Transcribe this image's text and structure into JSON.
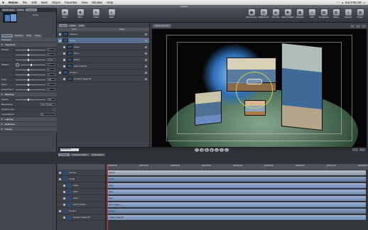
{
  "menubar": {
    "apple": "",
    "items": [
      "Motion",
      "File",
      "Edit",
      "Mark",
      "Object",
      "Favorites",
      "View",
      "Window",
      "Help"
    ],
    "clock": "Sat 9:08 AM"
  },
  "window": {
    "title": "untitled"
  },
  "toolbar": {
    "left": [
      {
        "label": "Select",
        "icon": "arrow-icon"
      },
      {
        "label": "Move",
        "icon": "move-icon"
      },
      {
        "label": "Create",
        "icon": "pen-icon"
      },
      {
        "label": "Mask",
        "icon": "mask-icon"
      }
    ],
    "right": [
      {
        "label": "New Camera",
        "icon": "camera-icon"
      },
      {
        "label": "Add Behavior",
        "icon": "gear-icon"
      },
      {
        "label": "Add Filter",
        "icon": "filter-icon"
      },
      {
        "label": "Make Particles",
        "icon": "particles-icon"
      },
      {
        "label": "Replicate",
        "icon": "replicate-icon"
      },
      {
        "label": "HUD",
        "icon": "hud-icon"
      },
      {
        "label": "File Browser",
        "icon": "folder-icon"
      },
      {
        "label": "Library",
        "icon": "library-icon"
      },
      {
        "label": "Inspector",
        "icon": "info-icon"
      },
      {
        "label": "Project",
        "icon": "project-icon"
      }
    ]
  },
  "left_panel": {
    "tabs": [
      "File Browser",
      "Library",
      "Inspector"
    ],
    "active_tab": "Inspector",
    "preview_name": "Group",
    "inspector_tabs": [
      "Properties",
      "Behaviors",
      "Filters",
      "Group"
    ],
    "active_inspector_tab": "Properties",
    "params": [
      {
        "name": "Parameter",
        "type": "hdr"
      },
      {
        "name": "Transform",
        "type": "section"
      },
      {
        "name": "Position",
        "value": "0",
        "ctrl": "slider"
      },
      {
        "name": "",
        "value": "0",
        "ctrl": "slider"
      },
      {
        "name": "",
        "value": "40.09",
        "ctrl": "slider"
      },
      {
        "name": "Rotation",
        "value": "0",
        "ctrl": "dial"
      },
      {
        "name": "",
        "value": "0",
        "ctrl": "slider"
      },
      {
        "name": "",
        "value": "0",
        "ctrl": "slider"
      },
      {
        "name": "Scale",
        "value": "100",
        "ctrl": "slider"
      },
      {
        "name": "Shear",
        "value": "0",
        "ctrl": "slider"
      },
      {
        "name": "Anchor Point",
        "value": "0",
        "ctrl": "slider"
      },
      {
        "name": "Blending",
        "type": "section"
      },
      {
        "name": "Opacity",
        "value": "100",
        "ctrl": "slider"
      },
      {
        "name": "Blend Mode",
        "value": "Pass Through",
        "ctrl": "popup"
      },
      {
        "name": "Preserve Opacity",
        "value": "",
        "ctrl": "check"
      },
      {
        "name": "Casts Reflection",
        "value": "No",
        "ctrl": "popup"
      },
      {
        "name": "Lighting",
        "type": "section"
      },
      {
        "name": "Reflection",
        "type": "section"
      },
      {
        "name": "Timing",
        "type": "section"
      }
    ]
  },
  "layers_panel": {
    "tabs": [
      "Layers",
      "Media",
      "Audio"
    ],
    "active_tab": "Layers",
    "columns": [
      "Name",
      "Status"
    ],
    "rows": [
      {
        "name": "Camera",
        "indent": 0,
        "selected": false
      },
      {
        "name": "Group",
        "indent": 0,
        "selected": true
      },
      {
        "name": "Apple",
        "indent": 1,
        "selected": false
      },
      {
        "name": "Hall 1",
        "indent": 1,
        "selected": false
      },
      {
        "name": "Hall 2",
        "indent": 1,
        "selected": false
      },
      {
        "name": "Hall of Hearts",
        "indent": 1,
        "selected": false
      },
      {
        "name": "Group 1",
        "indent": 0,
        "selected": false
      },
      {
        "name": "Gradient Stage 08",
        "indent": 1,
        "selected": false
      }
    ]
  },
  "canvas": {
    "view_menu": "Active Camera",
    "accent": "#c2d24a"
  },
  "transport": {
    "timecode": "00:00:00:00",
    "buttons": [
      "⏮",
      "◀",
      "▶",
      "▶",
      "⏭",
      "⟲",
      "🔊"
    ]
  },
  "timeline": {
    "tabs": [
      "Timeline",
      "Keyframe Editor",
      "Audio Editor"
    ],
    "active_tab": "Timeline",
    "ruler": [
      "00:00:00:00",
      "00:00:01:00",
      "00:00:02:00",
      "00:00:03:00",
      "00:00:04:00",
      "00:00:05:00",
      "00:00:06:00",
      "00:00:07:00",
      "00:00:08:00"
    ],
    "rows": [
      {
        "name": "Camera",
        "bar_label": "Camera",
        "kind": "cam"
      },
      {
        "name": "Group",
        "bar_label": "Group",
        "kind": "grp"
      },
      {
        "name": "Apple",
        "bar_label": "Apple",
        "kind": "layer"
      },
      {
        "name": "Hall 1",
        "bar_label": "Hall 1",
        "kind": "layer"
      },
      {
        "name": "Hall 2",
        "bar_label": "Hall 2",
        "kind": "layer"
      },
      {
        "name": "Hall of Hearts",
        "bar_label": "Hall of Hearts",
        "kind": "layer"
      },
      {
        "name": "Group 1",
        "bar_label": "Group 1",
        "kind": "grp"
      },
      {
        "name": "Gradient Stage 08",
        "bar_label": "Gradient Stage 08",
        "kind": "layer"
      }
    ]
  }
}
